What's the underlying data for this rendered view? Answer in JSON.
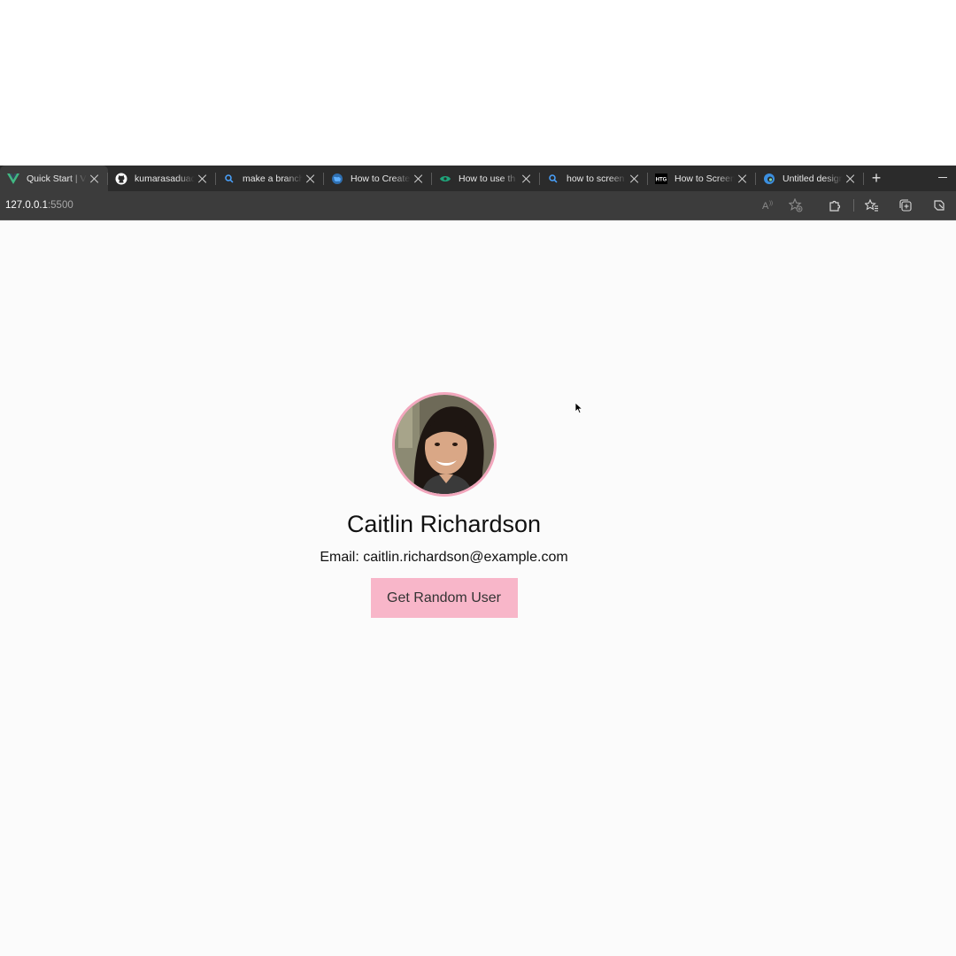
{
  "browser": {
    "tabs": [
      {
        "title": "Quick Start | Vue.js",
        "icon": "vue-icon",
        "active": true
      },
      {
        "title": "kumarasaduadara",
        "icon": "github-icon",
        "active": false
      },
      {
        "title": "make a branch",
        "icon": "search-icon",
        "active": false
      },
      {
        "title": "How to Create",
        "icon": "globe-icon",
        "active": false
      },
      {
        "title": "How to use th",
        "icon": "site-icon",
        "active": false
      },
      {
        "title": "how to screen",
        "icon": "search-icon",
        "active": false
      },
      {
        "title": "How to Screen",
        "icon": "htg-icon",
        "active": false
      },
      {
        "title": "Untitled design",
        "icon": "edge-icon",
        "active": false
      }
    ],
    "new_tab_label": "+",
    "address": {
      "host": "127.0.0.1",
      "port": ":5500"
    },
    "toolbar_icons": [
      "read-aloud-icon",
      "add-favorite-icon",
      "extensions-icon",
      "favorites-icon",
      "collections-icon",
      "copilot-icon"
    ]
  },
  "profile": {
    "name": "Caitlin Richardson",
    "email_line": "Email: caitlin.richardson@example.com",
    "button_label": "Get Random User"
  },
  "colors": {
    "accent_pink": "#f8b6c9",
    "avatar_border": "#f2a7bd",
    "tabstrip_bg": "#2b2b2b",
    "toolbar_bg": "#3c3c3c"
  }
}
